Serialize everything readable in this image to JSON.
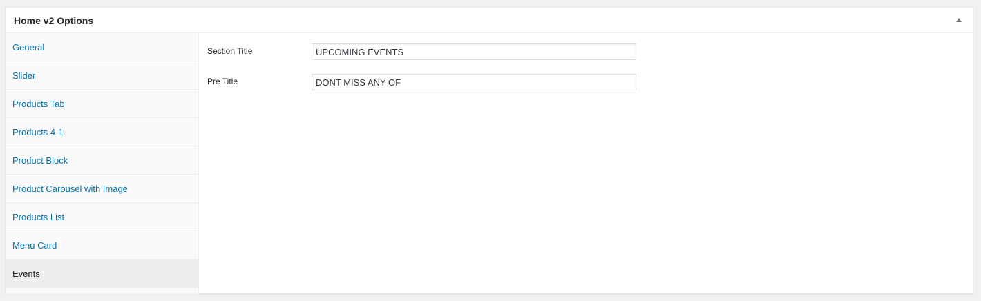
{
  "postbox": {
    "title": "Home v2 Options",
    "toggle_icon": "triangle-up-icon"
  },
  "tabs": [
    {
      "label": "General",
      "active": false
    },
    {
      "label": "Slider",
      "active": false
    },
    {
      "label": "Products Tab",
      "active": false
    },
    {
      "label": "Products 4-1",
      "active": false
    },
    {
      "label": "Product Block",
      "active": false
    },
    {
      "label": "Product Carousel with Image",
      "active": false
    },
    {
      "label": "Products List",
      "active": false
    },
    {
      "label": "Menu Card",
      "active": false
    },
    {
      "label": "Events",
      "active": true
    }
  ],
  "fields": {
    "section_title": {
      "label": "Section Title",
      "value": "UPCOMING EVENTS"
    },
    "pre_title": {
      "label": "Pre Title",
      "value": "DONT MISS ANY OF"
    }
  },
  "colors": {
    "link": "#0073aa",
    "active_tab_bg": "#eeeeee",
    "text": "#23282d"
  }
}
